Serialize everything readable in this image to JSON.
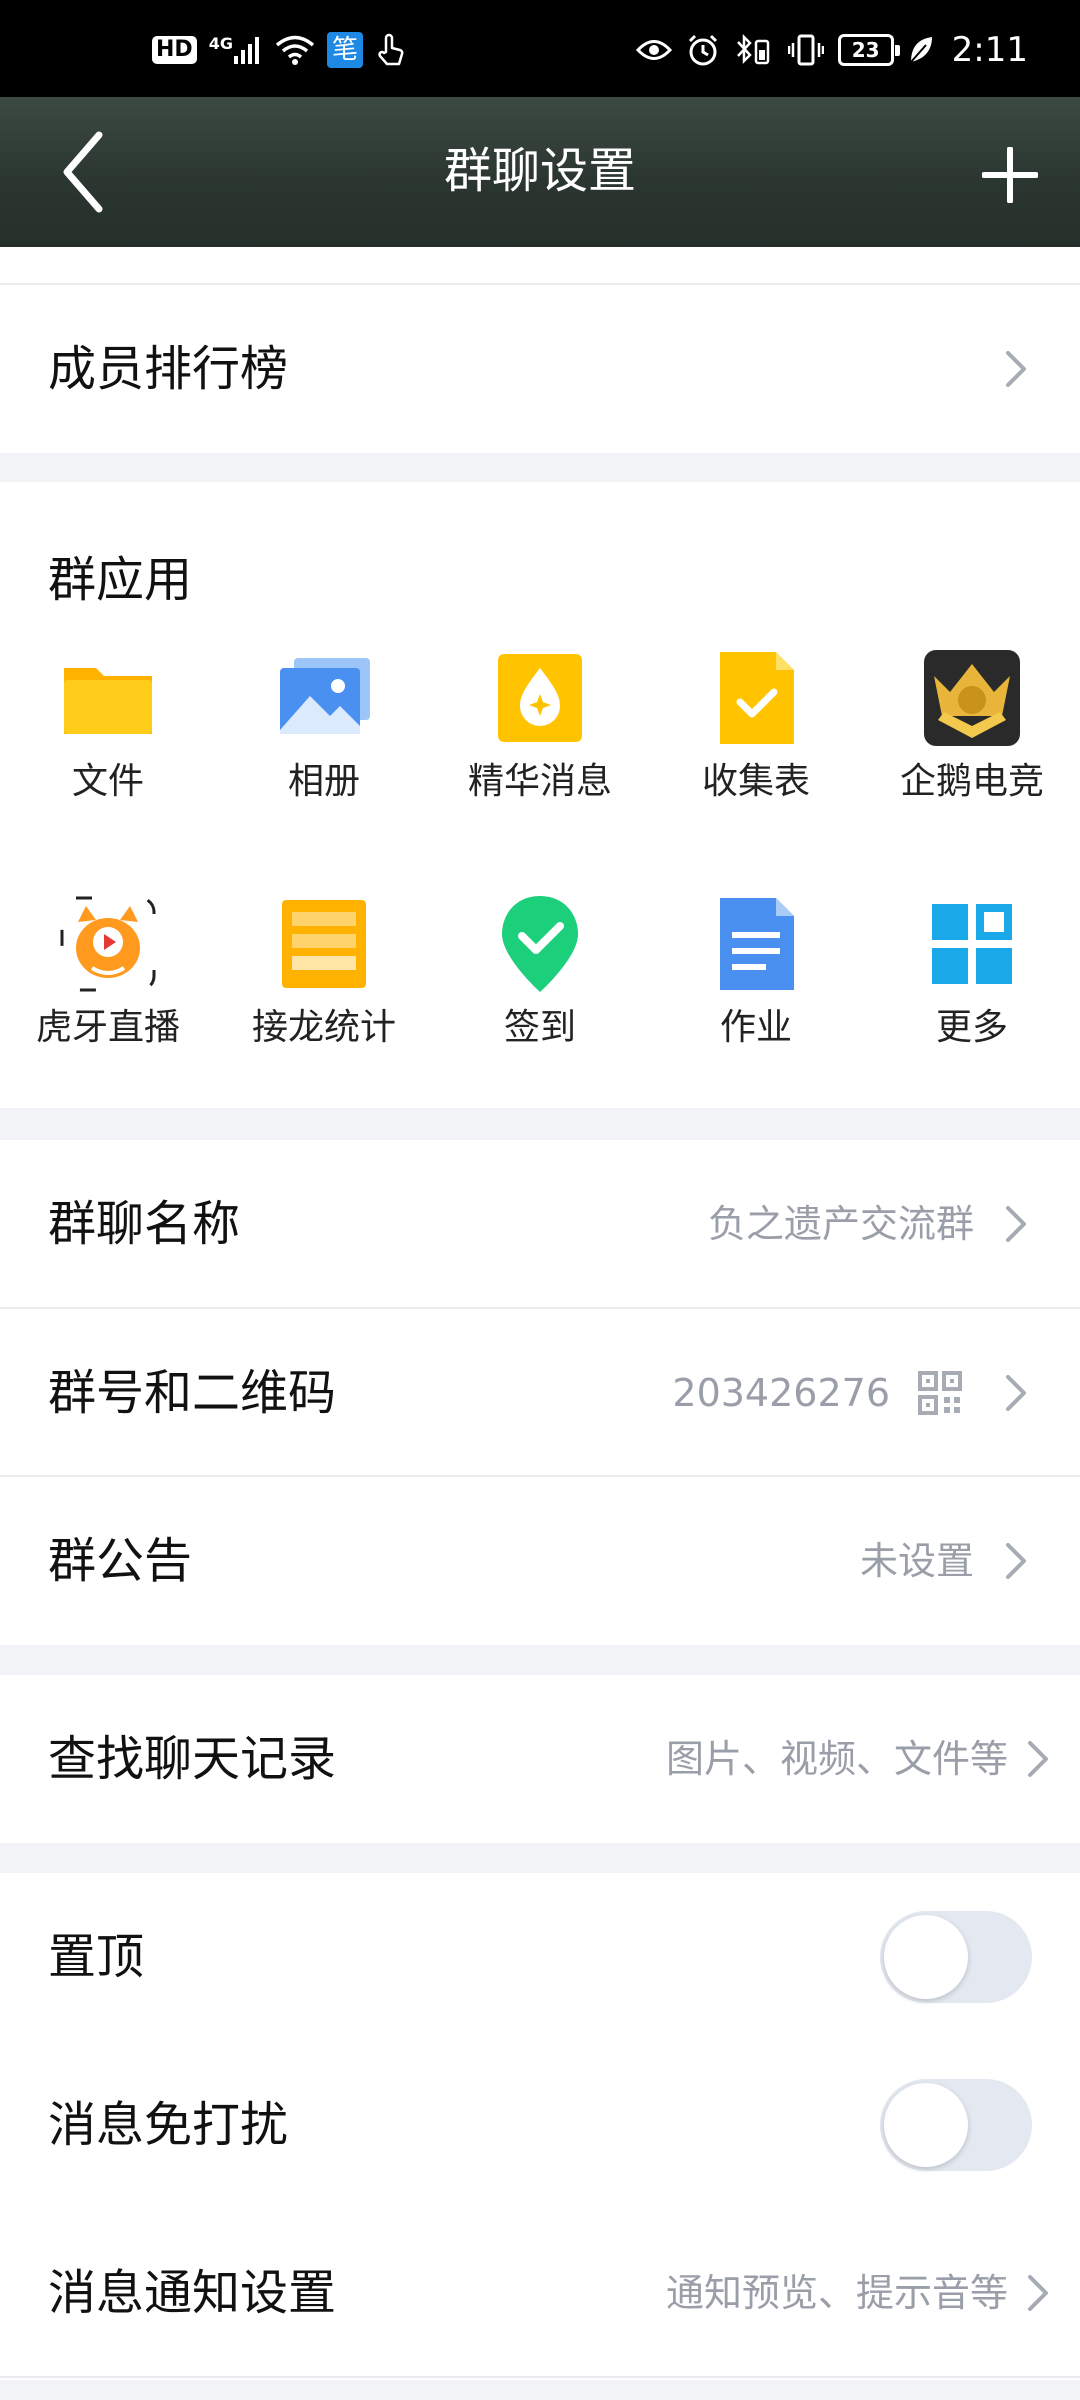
{
  "status_bar": {
    "hd_label": "HD",
    "network_label": "4G",
    "app_badge_char": "笔",
    "battery_level": "23",
    "time": "2:11"
  },
  "header": {
    "title": "群聊设置",
    "back_icon": "chevron-left-icon",
    "add_icon": "plus-icon"
  },
  "leaderboard": {
    "label": "成员排行榜"
  },
  "group_apps": {
    "title": "群应用",
    "items": [
      {
        "label": "文件",
        "icon": "folder-icon",
        "color": "#ffc300"
      },
      {
        "label": "相册",
        "icon": "photo-album-icon",
        "color": "#4a90f0"
      },
      {
        "label": "精华消息",
        "icon": "essence-message-icon",
        "color": "#ffc300"
      },
      {
        "label": "收集表",
        "icon": "collection-form-icon",
        "color": "#ffc300"
      },
      {
        "label": "企鹅电竞",
        "icon": "penguin-esports-icon",
        "color": "#2a2a2a"
      },
      {
        "label": "虎牙直播",
        "icon": "huya-live-icon",
        "color": "#ff9a1f"
      },
      {
        "label": "接龙统计",
        "icon": "relay-stats-icon",
        "color": "#ffb300"
      },
      {
        "label": "签到",
        "icon": "check-in-icon",
        "color": "#1ccf7b"
      },
      {
        "label": "作业",
        "icon": "homework-icon",
        "color": "#4a90f0"
      },
      {
        "label": "更多",
        "icon": "more-apps-icon",
        "color": "#1aa9e8"
      }
    ]
  },
  "group_info": {
    "name_label": "群聊名称",
    "name_value": "负之遗产交流群",
    "number_label": "群号和二维码",
    "number_value": "203426276",
    "notice_label": "群公告",
    "notice_value": "未设置"
  },
  "search_history": {
    "label": "查找聊天记录",
    "value": "图片、视频、文件等"
  },
  "settings": {
    "pin_label": "置顶",
    "pin_on": false,
    "mute_label": "消息免打扰",
    "mute_on": false,
    "notify_label": "消息通知设置",
    "notify_value": "通知预览、提示音等"
  }
}
